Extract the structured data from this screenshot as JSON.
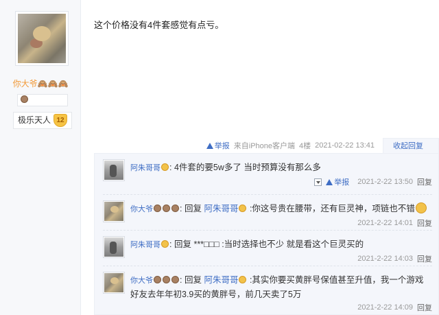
{
  "author": {
    "name": "你大爷🙈🙈🙈",
    "tag_label": "极乐天人",
    "tag_level": "12"
  },
  "post": {
    "content": "这个价格没有4件套感觉有点亏。",
    "report_label": "举报",
    "source": "来自iPhone客户端",
    "floor": "4楼",
    "time": "2021-02-22 13:41",
    "collapse_label": "收起回复"
  },
  "replies": [
    {
      "user": "阿朱哥哥",
      "text": "4件套的要5w多了 当时预算没有那么多",
      "report_label": "举报",
      "time": "2021-2-22 13:50",
      "reply_label": "回复"
    },
    {
      "user": "你大爷",
      "reply_word": "回复",
      "target": "阿朱哥哥",
      "text": ":你这号贵在腰带，还有巨灵神，项链也不错",
      "time": "2021-2-22 14:01",
      "reply_label": "回复"
    },
    {
      "user": "阿朱哥哥",
      "reply_word": "回复",
      "target": "***□□□",
      "text": ":当时选择也不少 就是看这个巨灵买的",
      "time": "2021-2-22 14:03",
      "reply_label": "回复"
    },
    {
      "user": "你大爷",
      "reply_word": "回复",
      "target": "阿朱哥哥",
      "text": ":其实你要买黄胖号保值甚至升值，我一个游戏好友去年年初3.9买的黄胖号，前几天卖了5万",
      "time": "2021-2-22 14:09",
      "reply_label": "回复"
    }
  ]
}
